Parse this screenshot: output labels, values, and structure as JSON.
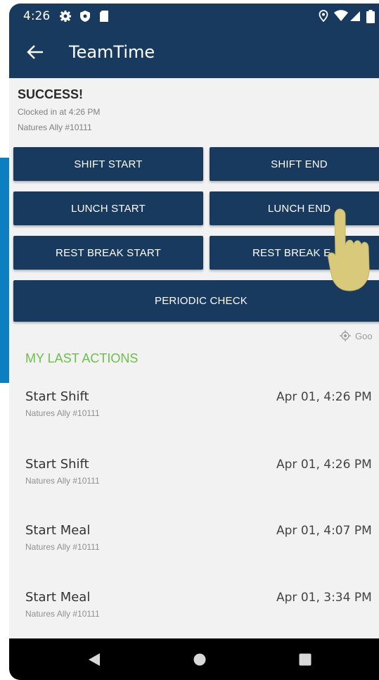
{
  "status": {
    "time": "4:26",
    "icons": [
      "gear-icon",
      "shield-icon",
      "sd-card-icon",
      "location-icon",
      "wifi-icon",
      "signal-icon",
      "battery-icon"
    ]
  },
  "appbar": {
    "title": "TeamTime",
    "back_icon": "back-arrow-icon"
  },
  "result": {
    "title": "SUCCESS!",
    "line1": "Clocked in at 4:26 PM",
    "line2": "Natures Ally #10111"
  },
  "buttons": {
    "shift_start": "SHIFT START",
    "shift_end": "SHIFT END",
    "lunch_start": "LUNCH START",
    "lunch_end": "LUNCH END",
    "rest_break_start": "REST BREAK START",
    "rest_break_end": "REST BREAK E",
    "periodic_check": "PERIODIC CHECK"
  },
  "gps": {
    "label": "Goo",
    "icon": "gps-target-icon"
  },
  "last_actions": {
    "heading": "MY LAST ACTIONS",
    "items": [
      {
        "title": "Start Shift",
        "location": "Natures Ally #10111",
        "time": "Apr 01, 4:26 PM"
      },
      {
        "title": "Start Shift",
        "location": "Natures Ally #10111",
        "time": "Apr 01, 4:26 PM"
      },
      {
        "title": "Start Meal",
        "location": "Natures Ally #10111",
        "time": "Apr 01, 4:07 PM"
      },
      {
        "title": "Start Meal",
        "location": "Natures Ally #10111",
        "time": "Apr 01, 3:34 PM"
      }
    ]
  },
  "colors": {
    "primary": "#173a5e",
    "accent_green": "#6cbf4a",
    "side_tab": "#0b7fc0",
    "hand_pointer": "#d9c97a"
  },
  "navbar": {
    "icons": [
      "back-triangle-icon",
      "home-circle-icon",
      "recents-square-icon"
    ]
  }
}
